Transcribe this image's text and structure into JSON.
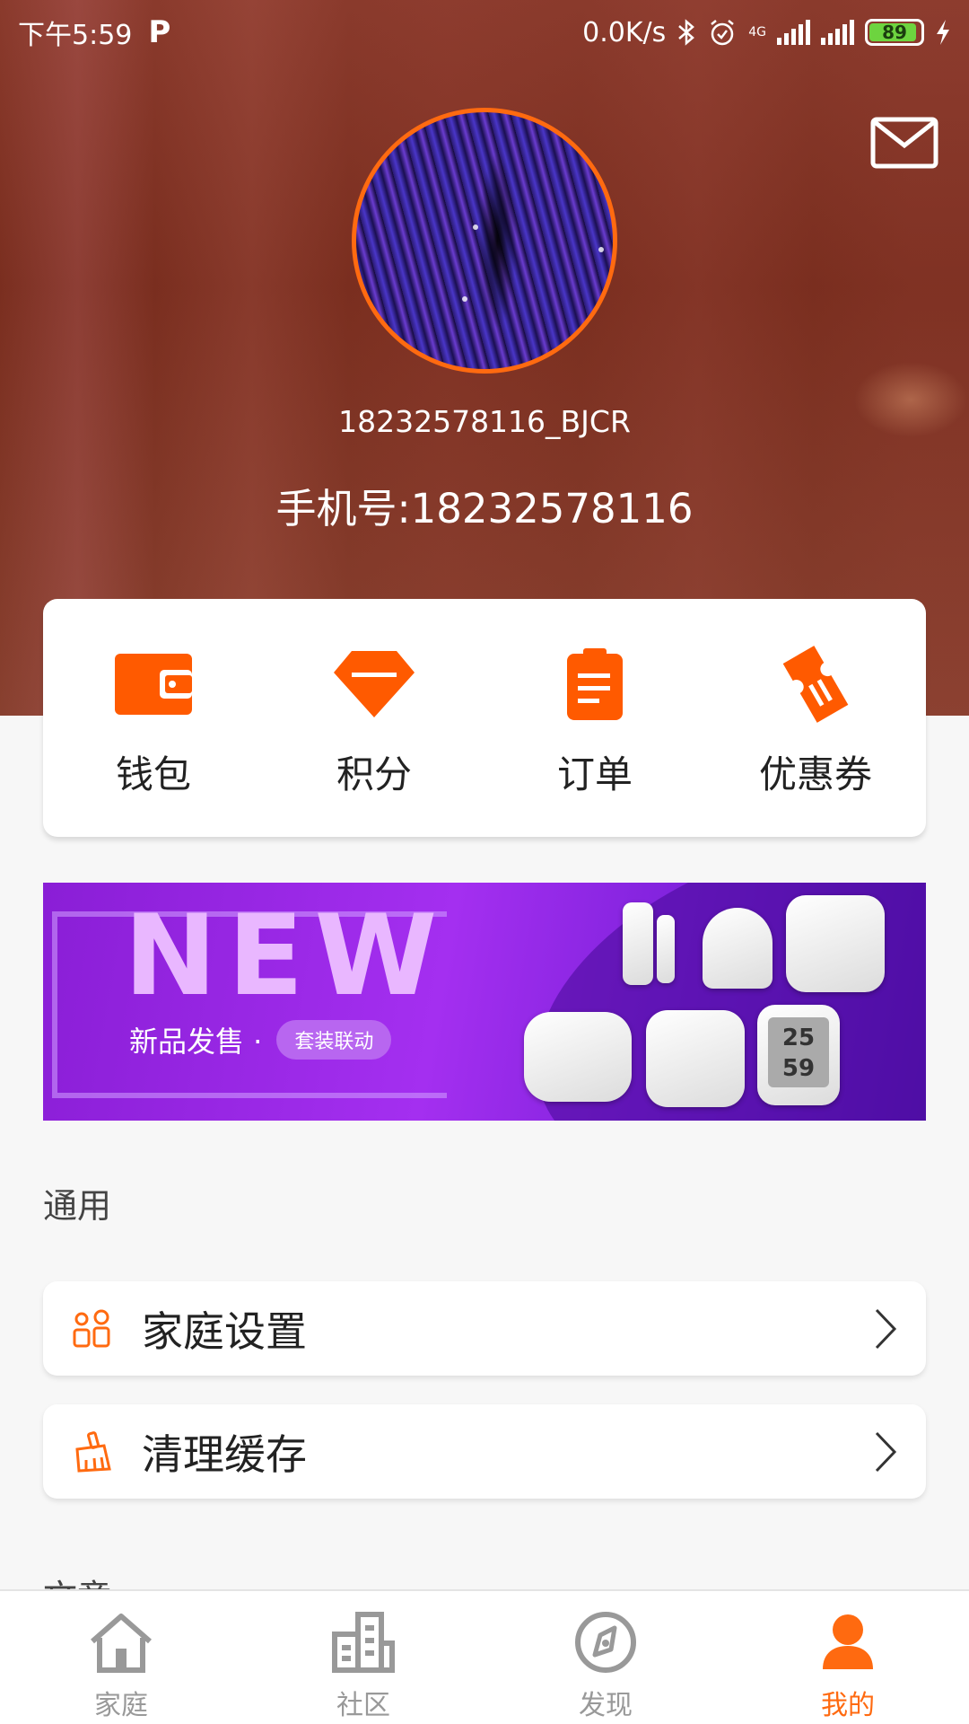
{
  "status_bar": {
    "time": "下午5:59",
    "app_indicator": "P",
    "network_speed": "0.0K/s",
    "network_type": "4G",
    "battery": "89"
  },
  "profile": {
    "username": "18232578116_BJCR",
    "phone": "手机号:18232578116"
  },
  "quick_actions": [
    {
      "label": "钱包",
      "icon": "wallet-icon"
    },
    {
      "label": "积分",
      "icon": "points-diamond-icon"
    },
    {
      "label": "订单",
      "icon": "order-clipboard-icon"
    },
    {
      "label": "优惠券",
      "icon": "coupon-icon"
    }
  ],
  "banner": {
    "headline": "NEW",
    "subtitle": "新品发售 ·",
    "pill": "套装联动",
    "device_reading_1": "25",
    "device_reading_2": "59"
  },
  "general_section": {
    "title": "通用",
    "items": [
      {
        "label": "家庭设置",
        "icon": "family-settings-icon"
      },
      {
        "label": "清理缓存",
        "icon": "broom-icon"
      }
    ]
  },
  "next_section_title": "文章",
  "bottom_nav": [
    {
      "label": "家庭",
      "icon": "home-icon",
      "active": false
    },
    {
      "label": "社区",
      "icon": "community-building-icon",
      "active": false
    },
    {
      "label": "发现",
      "icon": "discover-compass-icon",
      "active": false
    },
    {
      "label": "我的",
      "icon": "profile-icon",
      "active": true
    }
  ],
  "colors": {
    "accent": "#ff6a10",
    "nav_inactive": "#999999",
    "hero_background": "#7a2e1f",
    "banner_purple": "#a42ff0"
  }
}
